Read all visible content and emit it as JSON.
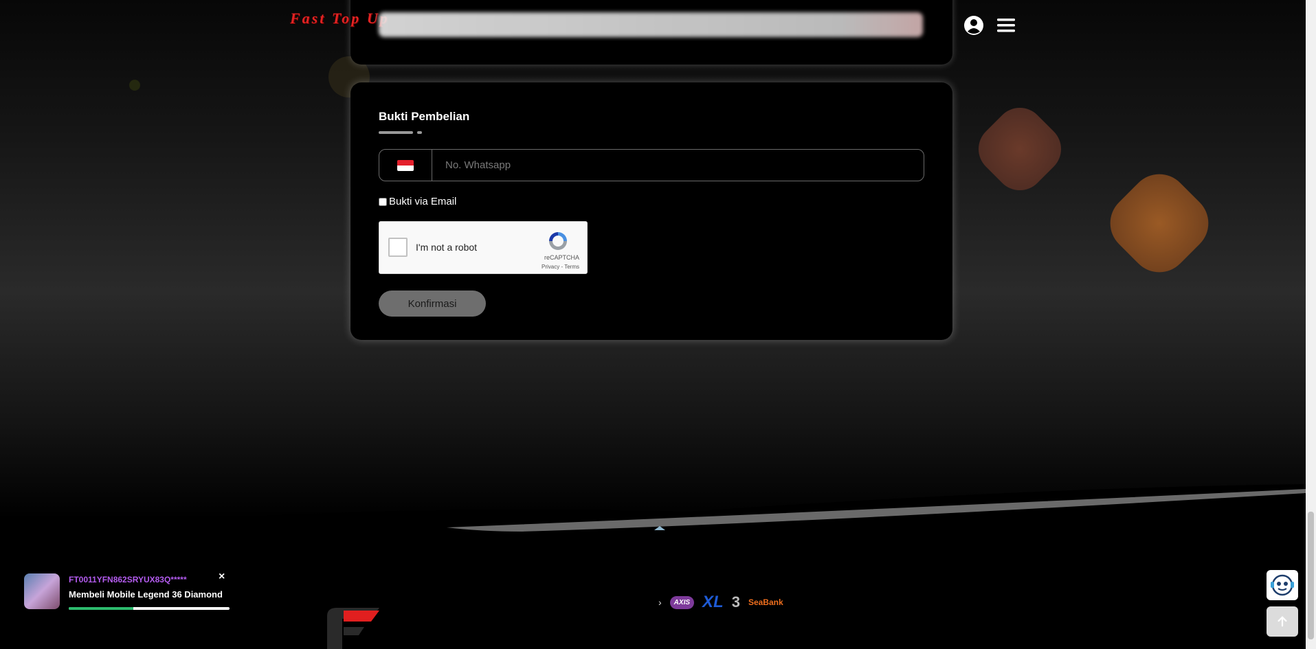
{
  "header": {
    "logo_text": "Fast Top Up",
    "user_icon": "user-circle-icon",
    "menu_icon": "hamburger-menu-icon"
  },
  "purchase_proof": {
    "title": "Bukti Pembelian",
    "country_flag": "indonesia-flag",
    "whatsapp_placeholder": "No. Whatsapp",
    "email_checkbox_label": "Bukti via Email",
    "email_checked": false,
    "recaptcha": {
      "label": "I'm not a robot",
      "brand": "reCAPTCHA",
      "links": "Privacy - Terms"
    },
    "confirm_label": "Konfirmasi"
  },
  "notification": {
    "transaction_id": "FT0011YFN862SRYUX83Q*****",
    "message": "Membeli Mobile Legend 36 Diamond",
    "close_label": "×",
    "progress_fraction": 0.4
  },
  "payment_logos": [
    "seabank-mark",
    "AXIS",
    "XL",
    "3",
    "SeaBank"
  ],
  "payment_labels": {
    "axis": "AXIS",
    "xl": "XL",
    "three": "3",
    "seabank": "SeaBank"
  },
  "floating": {
    "chat_icon": "chat-support-icon",
    "top_icon": "arrow-up-icon"
  },
  "colors": {
    "brand_red": "#e12323",
    "notif_id": "#b45cf0",
    "progress": "#2dbb6e"
  }
}
